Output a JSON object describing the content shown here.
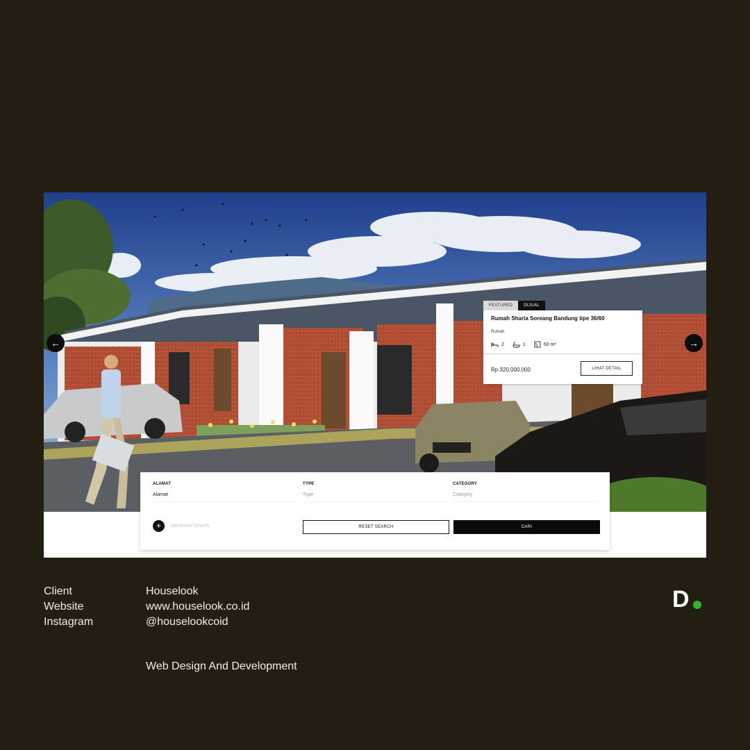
{
  "hero": {
    "prev_arrow": "←",
    "next_arrow": "→"
  },
  "listing": {
    "badges": [
      "FEATURED",
      "DIJUAL"
    ],
    "title": "Rumah Sharia Soreang Bandung tipe 36/60",
    "type": "Rumah",
    "bedrooms": "2",
    "bathrooms": "1",
    "area": "60 m²",
    "price": "Rp 320.000.000",
    "detail_button": "LIHAT DETAIL"
  },
  "search": {
    "alamat_label": "ALAMAT",
    "alamat_value": "Alamat",
    "type_label": "TYPE",
    "type_placeholder": "Type",
    "category_label": "CATEGORY",
    "category_placeholder": "Category",
    "advanced_plus": "+",
    "advanced_search": "Advanced Search",
    "reset_button": "RESET SEARCH",
    "submit_button": "CARI"
  },
  "info": {
    "labels": [
      "Client",
      "Website",
      "Instagram"
    ],
    "values": [
      "Houselook",
      "www.houselook.co.id",
      "@houselookcoid"
    ],
    "service": "Web Design And Development"
  },
  "logo": {
    "letter": "D",
    "dot_color": "#2fb52f"
  },
  "colors": {
    "background": "#231d12",
    "accent_dark": "#0a0a0a"
  },
  "icons": [
    "arrow-left-icon",
    "arrow-right-icon",
    "bed-icon",
    "bath-icon",
    "area-icon",
    "plus-icon"
  ]
}
